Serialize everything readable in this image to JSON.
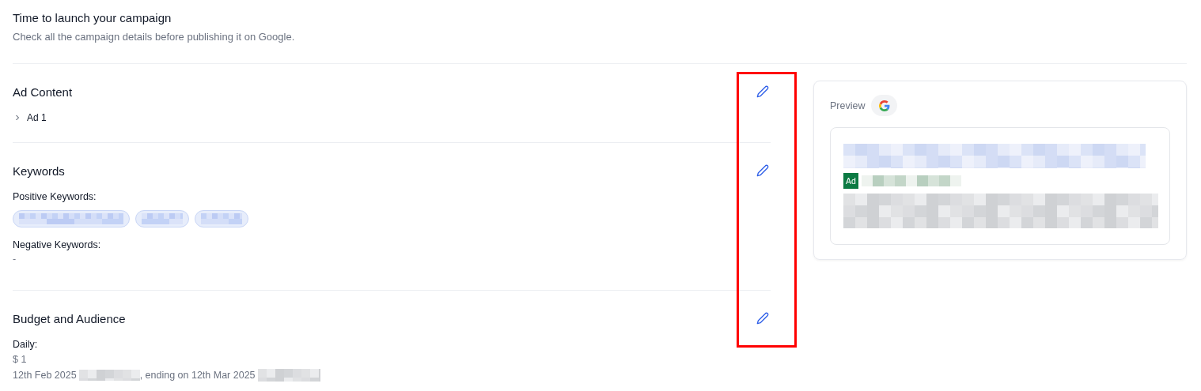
{
  "header": {
    "title": "Time to launch your campaign",
    "subtitle": "Check all the campaign details before publishing it on Google."
  },
  "sections": [
    {
      "kind": "ads",
      "title": "Ad Content",
      "ads": [
        {
          "label": "Ad 1",
          "expanded": false
        }
      ]
    },
    {
      "kind": "keywords",
      "title": "Keywords",
      "positive_label": "Positive Keywords:",
      "positive_keywords": [
        {
          "kind": "wide"
        },
        {
          "kind": "narrow"
        },
        {
          "kind": "narrow"
        }
      ],
      "negative_label": "Negative Keywords:",
      "negative_value": "-"
    },
    {
      "kind": "budget",
      "title": "Budget and Audience",
      "budget_label": "Daily:",
      "budget_value": "$ 1",
      "start_date": "12th Feb 2025",
      "end_text": ", ending on 12th Mar 2025"
    }
  ],
  "preview": {
    "label": "Preview",
    "ad_badge": "Ad"
  },
  "annotation": {
    "kind": "highlight"
  }
}
